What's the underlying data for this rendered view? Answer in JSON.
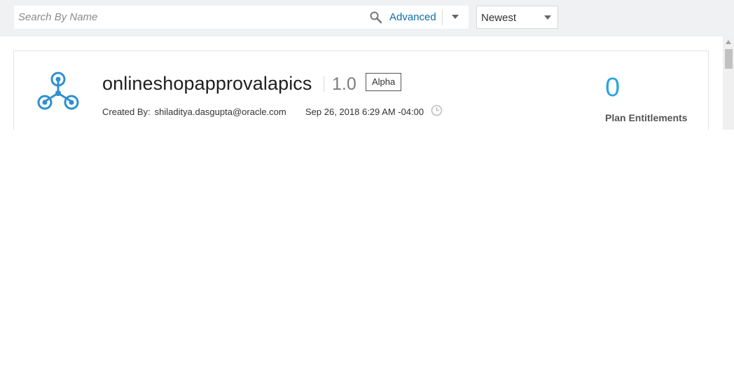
{
  "search": {
    "placeholder": "Search By Name",
    "value": "",
    "advanced_label": "Advanced"
  },
  "sort": {
    "selected": "Newest"
  },
  "api_card": {
    "name": "onlineshopapprovalapics",
    "version": "1.0",
    "state": "Alpha",
    "created_by_label": "Created By:",
    "created_by": "shiladitya.dasgupta@oracle.com",
    "created_date": "Sep 26, 2018 6:29 AM -04:00",
    "entitlements_count": "0",
    "entitlements_label": "Plan Entitlements"
  },
  "colors": {
    "accent": "#2ea6dd",
    "link": "#0a6ea5",
    "topbar_bg": "#f0f1f3"
  },
  "icons": [
    "search-icon",
    "chevron-down-icon",
    "api-icon",
    "clock-icon"
  ]
}
